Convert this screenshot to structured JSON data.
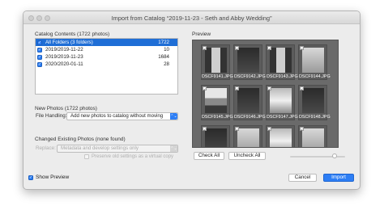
{
  "window": {
    "title": "Import from Catalog “2019-11-23 - Seth and Abby Wedding”"
  },
  "catalog": {
    "heading": "Catalog Contents (1722 photos)",
    "rows": [
      {
        "label": "All Folders (3 folders)",
        "count": "1722",
        "checked": true,
        "selected": true
      },
      {
        "label": "2019/2019-11-22",
        "count": "10",
        "checked": true,
        "selected": false
      },
      {
        "label": "2019/2019-11-23",
        "count": "1684",
        "checked": true,
        "selected": false
      },
      {
        "label": "2020/2020-01-11",
        "count": "28",
        "checked": true,
        "selected": false
      }
    ]
  },
  "new_photos": {
    "heading": "New Photos (1722 photos)",
    "file_handling_label": "File Handling:",
    "file_handling_value": "Add new photos to catalog without moving"
  },
  "changed": {
    "heading": "Changed Existing Photos (none found)",
    "replace_label": "Replace:",
    "replace_value": "Metadata and develop settings only",
    "preserve_label": "Preserve old settings as a virtual copy"
  },
  "preview": {
    "heading": "Preview",
    "thumbnails": [
      {
        "name": "DSCF9141.JPG",
        "style": "door"
      },
      {
        "name": "DSCF9142.JPG",
        "style": "dark"
      },
      {
        "name": "DSCF9143.JPG",
        "style": "door"
      },
      {
        "name": "DSCF9144.JPG",
        "style": "light"
      },
      {
        "name": "DSCF9145.JPG",
        "style": "house"
      },
      {
        "name": "DSCF9146.JPG",
        "style": "dark"
      },
      {
        "name": "DSCF9147.JPG",
        "style": "dress"
      },
      {
        "name": "DSCF9148.JPG",
        "style": "dark"
      },
      {
        "name": "",
        "style": "dark"
      },
      {
        "name": "",
        "style": "light"
      },
      {
        "name": "",
        "style": "dress"
      },
      {
        "name": "",
        "style": "light"
      }
    ],
    "check_all_label": "Check All",
    "uncheck_all_label": "Uncheck All"
  },
  "footer": {
    "show_preview_label": "Show Preview",
    "cancel_label": "Cancel",
    "import_label": "Import"
  },
  "icons": {
    "checkmark": "✓",
    "chevrons": "⌃⌄"
  },
  "colors": {
    "accent": "#2d7ef5",
    "selection": "#1f6ed6"
  }
}
